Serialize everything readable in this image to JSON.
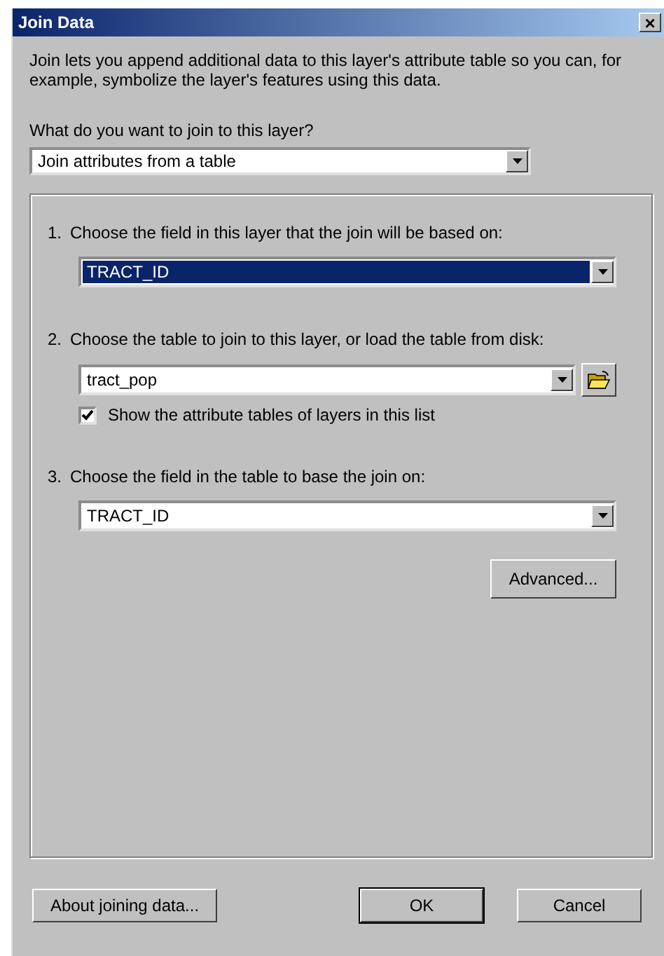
{
  "window": {
    "title": "Join Data",
    "close": "×"
  },
  "intro": "Join lets you append additional data to this layer's attribute table so you can, for example, symbolize the layer's features using this data.",
  "question": "What do you want to join to this layer?",
  "join_type": {
    "value": "Join attributes from a table"
  },
  "steps": [
    {
      "number": "1.",
      "label": "Choose the field in this layer that the join will be based on:",
      "dropdown": {
        "value": "TRACT_ID",
        "focused": true
      }
    },
    {
      "number": "2.",
      "label": "Choose the table to join to this layer, or load the table from disk:",
      "dropdown": {
        "value": "tract_pop",
        "focused": false
      },
      "browse": true,
      "checkbox": {
        "label": "Show the attribute tables of layers in this list",
        "checked": true
      }
    },
    {
      "number": "3.",
      "label": "Choose the field in the table to base the join on:",
      "dropdown": {
        "value": "TRACT_ID",
        "focused": false
      }
    }
  ],
  "advanced_button": "Advanced...",
  "buttons": [
    {
      "label": "About joining data...",
      "default": false
    },
    {
      "label": "OK",
      "default": true
    },
    {
      "label": "Cancel",
      "default": false
    }
  ]
}
